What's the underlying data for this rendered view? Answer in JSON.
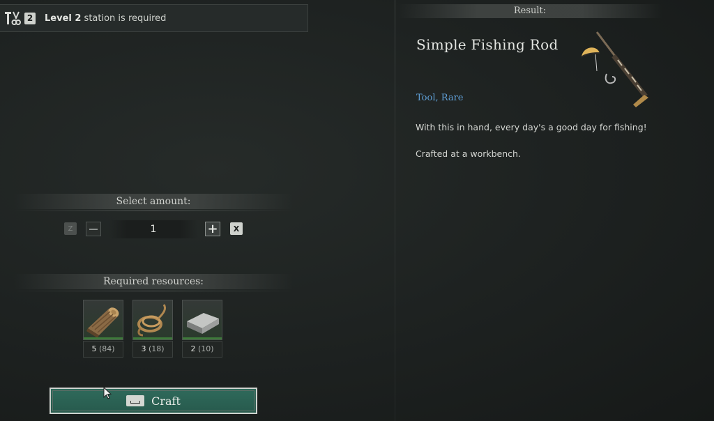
{
  "requirement": {
    "level_badge": "2",
    "level_label": "Level 2",
    "suffix": " station is required"
  },
  "amount": {
    "header": "Select amount:",
    "decrease_key": "Z",
    "value": "1",
    "increase_key": "X"
  },
  "resources": {
    "header": "Required resources:",
    "items": [
      {
        "icon": "wood-log-icon",
        "needed": "5",
        "have": "(84)"
      },
      {
        "icon": "rope-icon",
        "needed": "3",
        "have": "(18)"
      },
      {
        "icon": "metal-ingot-icon",
        "needed": "2",
        "have": "(10)"
      }
    ]
  },
  "craft_button": {
    "label": "Craft"
  },
  "result": {
    "header": "Result:",
    "name": "Simple Fishing Rod",
    "tags": "Tool, Rare",
    "description": "With this in hand, every day's a good day for fishing!",
    "crafted_at": "Crafted at a workbench.",
    "icon": "fishing-rod-icon"
  },
  "colors": {
    "craft_button_bg": "#2f6a5b",
    "rarity_text": "#5f9fd6",
    "resource_available": "#3e7a3a"
  }
}
